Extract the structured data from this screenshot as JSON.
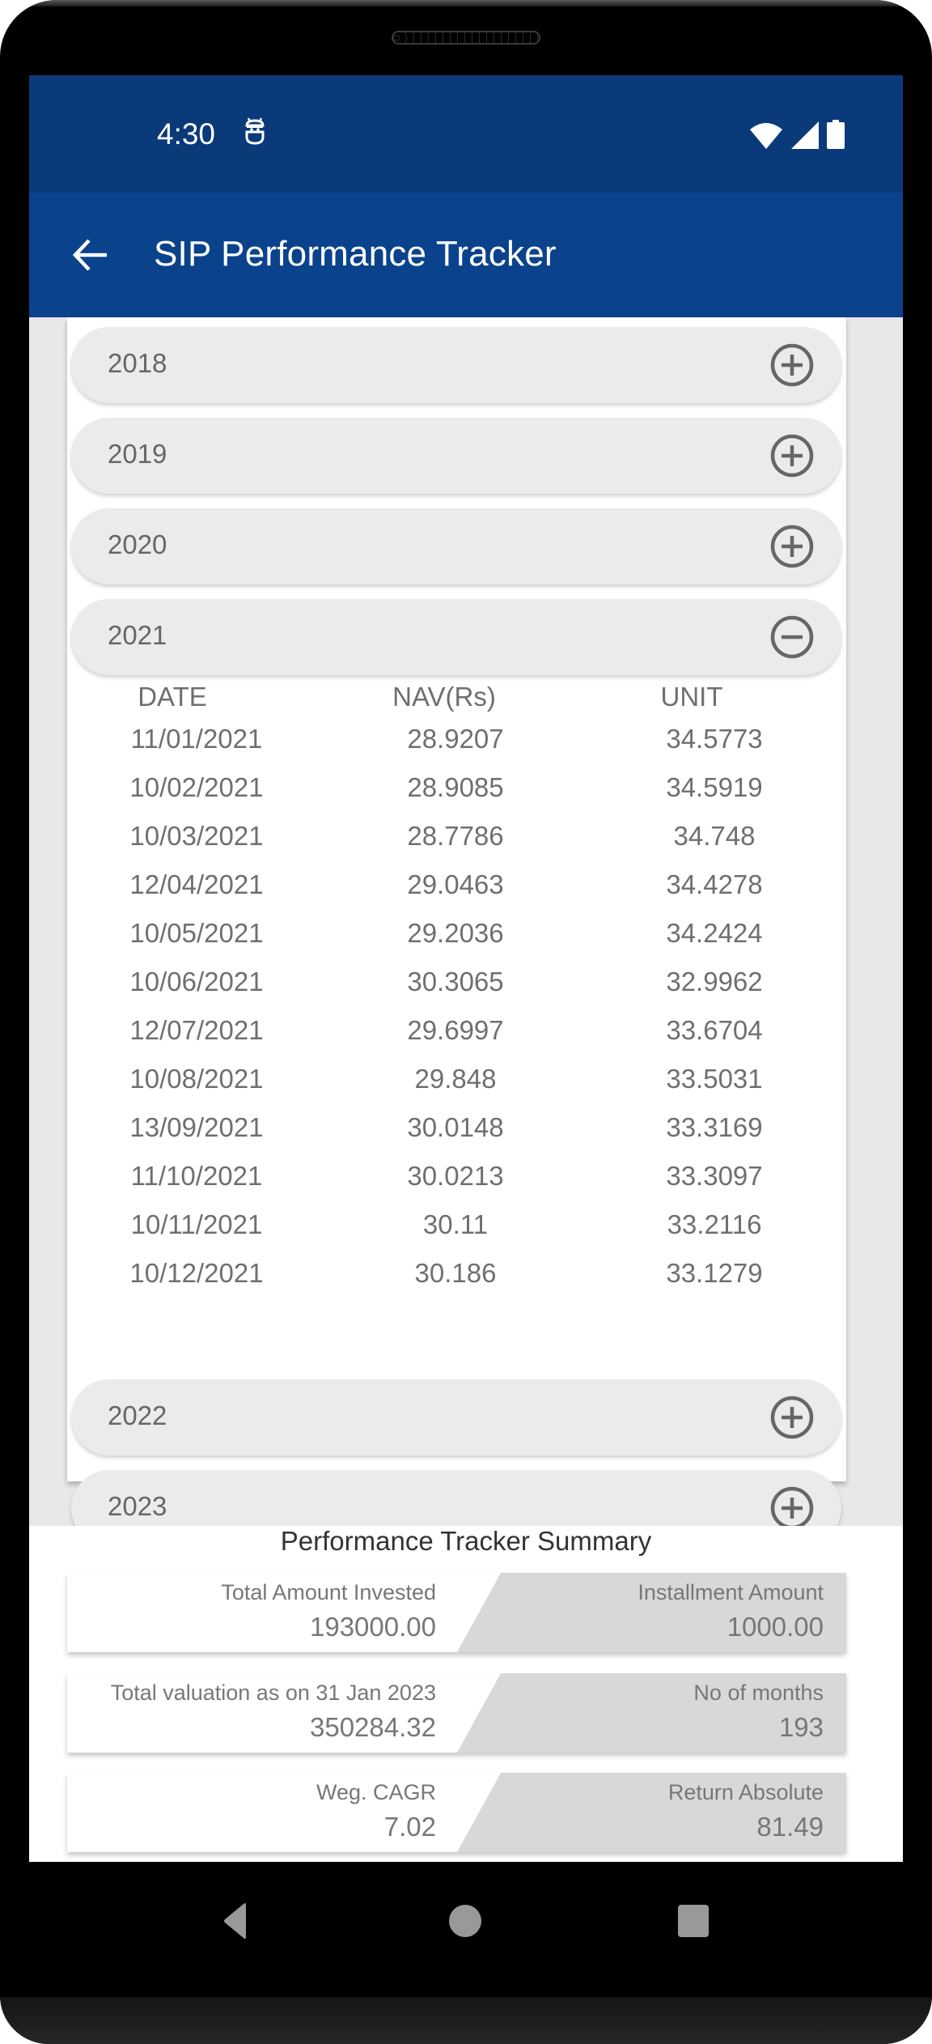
{
  "status_bar": {
    "time": "4:30",
    "notification_icon": "android-debug-icon",
    "icons": [
      "wifi-icon",
      "cellular-signal-icon",
      "battery-icon"
    ]
  },
  "app_bar": {
    "back_icon": "arrow-left-icon",
    "title": "SIP Performance Tracker"
  },
  "years": [
    {
      "label": "2018",
      "expanded": false,
      "icon": "plus-circle-icon"
    },
    {
      "label": "2019",
      "expanded": false,
      "icon": "plus-circle-icon"
    },
    {
      "label": "2020",
      "expanded": false,
      "icon": "plus-circle-icon"
    },
    {
      "label": "2021",
      "expanded": true,
      "icon": "minus-circle-icon"
    },
    {
      "label": "2022",
      "expanded": false,
      "icon": "plus-circle-icon"
    },
    {
      "label": "2023",
      "expanded": false,
      "icon": "plus-circle-icon"
    }
  ],
  "table": {
    "headers": {
      "date": "DATE",
      "nav": "NAV(Rs)",
      "unit": "UNIT"
    },
    "rows": [
      {
        "date": "11/01/2021",
        "nav": "28.9207",
        "unit": "34.5773"
      },
      {
        "date": "10/02/2021",
        "nav": "28.9085",
        "unit": "34.5919"
      },
      {
        "date": "10/03/2021",
        "nav": "28.7786",
        "unit": "34.748"
      },
      {
        "date": "12/04/2021",
        "nav": "29.0463",
        "unit": "34.4278"
      },
      {
        "date": "10/05/2021",
        "nav": "29.2036",
        "unit": "34.2424"
      },
      {
        "date": "10/06/2021",
        "nav": "30.3065",
        "unit": "32.9962"
      },
      {
        "date": "12/07/2021",
        "nav": "29.6997",
        "unit": "33.6704"
      },
      {
        "date": "10/08/2021",
        "nav": "29.848",
        "unit": "33.5031"
      },
      {
        "date": "13/09/2021",
        "nav": "30.0148",
        "unit": "33.3169"
      },
      {
        "date": "11/10/2021",
        "nav": "30.0213",
        "unit": "33.3097"
      },
      {
        "date": "10/11/2021",
        "nav": "30.11",
        "unit": "33.2116"
      },
      {
        "date": "10/12/2021",
        "nav": "30.186",
        "unit": "33.1279"
      }
    ]
  },
  "summary": {
    "title": "Performance Tracker Summary",
    "boxes": [
      {
        "left_label": "Total Amount Invested",
        "left_value": "193000.00",
        "right_label": "Installment Amount",
        "right_value": "1000.00"
      },
      {
        "left_label": "Total valuation as on 31 Jan 2023",
        "left_value": "350284.32",
        "right_label": "No of months",
        "right_value": "193"
      },
      {
        "left_label": "Weg. CAGR",
        "left_value": "7.02",
        "right_label": "Return Absolute",
        "right_value": "81.49"
      }
    ]
  },
  "nav_bar": {
    "buttons": [
      "nav-back-icon",
      "nav-home-icon",
      "nav-recents-icon"
    ]
  },
  "colors": {
    "status_bar": "#0a3a7a",
    "app_bar": "#0b428c",
    "pill_bg": "#ebebeb",
    "summary_right_bg": "#d8d8d8",
    "text_gray": "#6f6f6f"
  }
}
